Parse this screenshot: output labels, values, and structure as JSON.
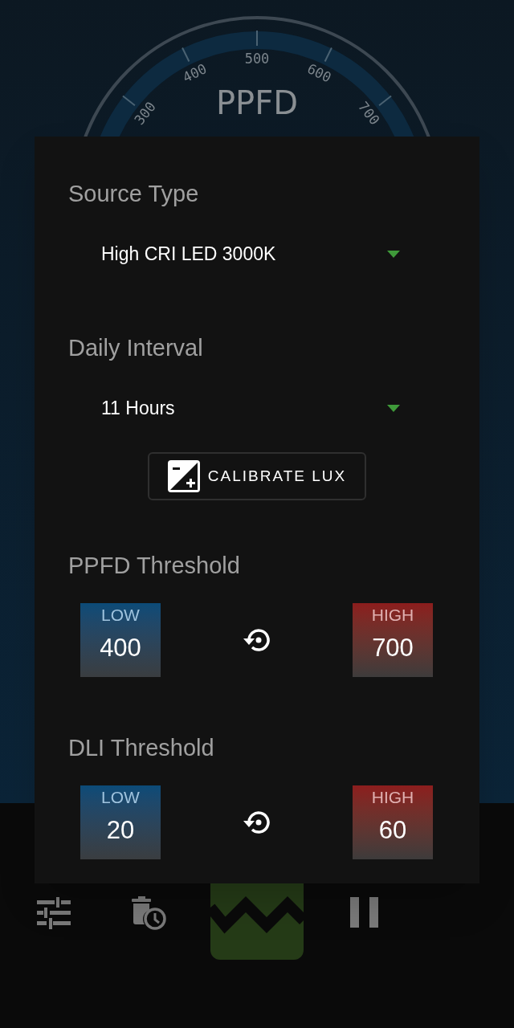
{
  "gauge": {
    "title": "PPFD",
    "ticks": [
      "300",
      "400",
      "500",
      "600",
      "700"
    ]
  },
  "dialog": {
    "sections": [
      {
        "kind": "dropdown",
        "label": "Source Type",
        "value": "High CRI LED 3000K"
      },
      {
        "kind": "dropdown",
        "label": "Daily Interval",
        "value": "11 Hours"
      },
      {
        "kind": "button",
        "label": "CALIBRATE LUX"
      },
      {
        "kind": "threshold",
        "label": "PPFD Threshold",
        "low": {
          "label": "LOW",
          "value": "400"
        },
        "high": {
          "label": "HIGH",
          "value": "700"
        }
      },
      {
        "kind": "threshold",
        "label": "DLI Threshold",
        "low": {
          "label": "LOW",
          "value": "20"
        },
        "high": {
          "label": "HIGH",
          "value": "60"
        }
      }
    ]
  }
}
